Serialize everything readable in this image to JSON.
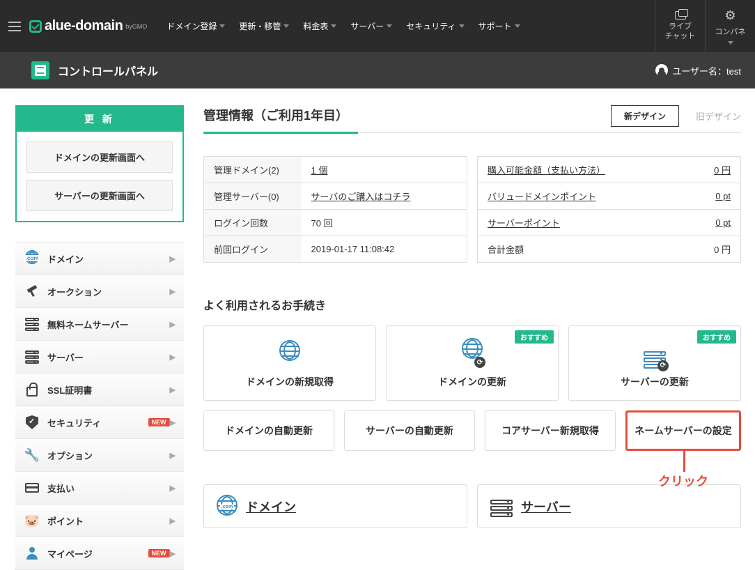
{
  "header": {
    "logo": "alue-domain",
    "logo_sub": "byGMO",
    "nav": [
      "ドメイン登録",
      "更新・移管",
      "料金表",
      "サーバー",
      "セキュリティ",
      "サポート"
    ],
    "live_chat": "ライブ\nチャット",
    "conpane": "コンパネ"
  },
  "subheader": {
    "title": "コントロールパネル",
    "user_label": "ユーザー名：",
    "user_name": "test"
  },
  "sidebar": {
    "update_title": "更 新",
    "update_buttons": [
      "ドメインの更新画面へ",
      "サーバーの更新画面へ"
    ],
    "menu": [
      {
        "label": "ドメイン"
      },
      {
        "label": "オークション"
      },
      {
        "label": "無料ネームサーバー"
      },
      {
        "label": "サーバー"
      },
      {
        "label": "SSL証明書"
      },
      {
        "label": "セキュリティ",
        "badge": "NEW"
      },
      {
        "label": "オプション"
      },
      {
        "label": "支払い"
      },
      {
        "label": "ポイント"
      },
      {
        "label": "マイページ",
        "badge": "NEW"
      }
    ]
  },
  "content": {
    "title": "管理情報（ご利用1年目）",
    "design_new": "新デザイン",
    "design_old": "旧デザイン",
    "left_table": [
      {
        "label": "管理ドメイン(2)",
        "value": "1 個",
        "link": true
      },
      {
        "label": "管理サーバー(0)",
        "value": "サーバのご購入はコチラ",
        "link": true
      },
      {
        "label": "ログイン回数",
        "value": "70 回"
      },
      {
        "label": "前回ログイン",
        "value": "2019-01-17 11:08:42"
      }
    ],
    "right_table": [
      {
        "label": "購入可能金額（支払い方法）",
        "label_link": true,
        "value": "0 円",
        "link": true
      },
      {
        "label": "バリュードメインポイント",
        "label_link": true,
        "value": "0 pt",
        "link": true
      },
      {
        "label": "サーバーポイント",
        "label_link": true,
        "value": "0 pt",
        "link": true
      },
      {
        "label": "合計金額",
        "value": "0 円"
      }
    ],
    "procedures_title": "よく利用されるお手続き",
    "rec_label": "おすすめ",
    "proc_big": [
      "ドメインの新規取得",
      "ドメインの更新",
      "サーバーの更新"
    ],
    "proc_small": [
      "ドメインの自動更新",
      "サーバーの自動更新",
      "コアサーバー新規取得",
      "ネームサーバーの設定"
    ],
    "click_label": "クリック",
    "bottom": [
      "ドメイン",
      "サーバー"
    ]
  }
}
